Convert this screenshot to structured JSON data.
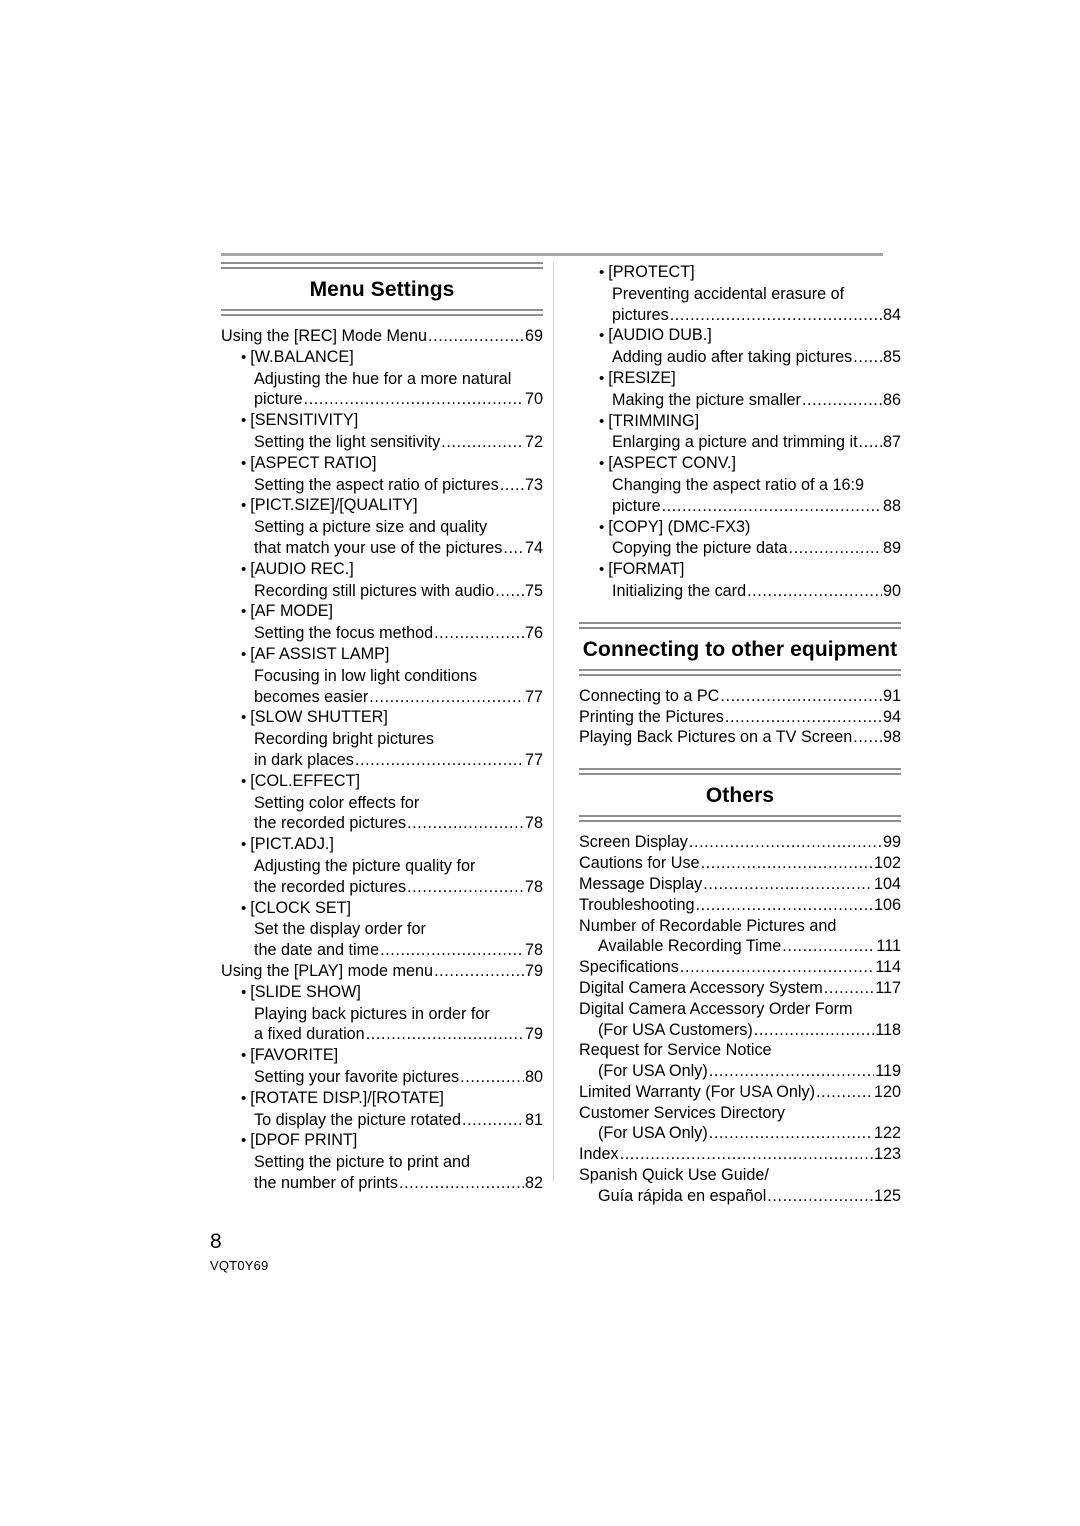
{
  "document": {
    "page_number": "8",
    "doc_code": "VQT0Y69"
  },
  "sections": {
    "menu_settings": {
      "title": "Menu Settings",
      "entries": [
        {
          "kind": "lvl1",
          "text": "Using the [REC] Mode Menu",
          "page": "69"
        },
        {
          "kind": "bullet",
          "text": "[W.BALANCE]"
        },
        {
          "kind": "desc",
          "text": "Adjusting the hue for a more natural"
        },
        {
          "kind": "desc",
          "text": "picture",
          "page": "70"
        },
        {
          "kind": "bullet",
          "text": "[SENSITIVITY]"
        },
        {
          "kind": "desc",
          "text": "Setting the light sensitivity",
          "page": "72"
        },
        {
          "kind": "bullet",
          "text": "[ASPECT RATIO]"
        },
        {
          "kind": "desc",
          "text": "Setting the aspect ratio of pictures",
          "page": "73"
        },
        {
          "kind": "bullet",
          "text": "[PICT.SIZE]/[QUALITY]"
        },
        {
          "kind": "desc",
          "text": "Setting a picture size and quality"
        },
        {
          "kind": "desc",
          "text": "that match your use of the pictures",
          "page": "74"
        },
        {
          "kind": "bullet",
          "text": "[AUDIO REC.]"
        },
        {
          "kind": "desc",
          "text": "Recording still pictures with audio",
          "page": "75"
        },
        {
          "kind": "bullet",
          "text": "[AF MODE]"
        },
        {
          "kind": "desc",
          "text": "Setting the focus method",
          "page": "76"
        },
        {
          "kind": "bullet",
          "text": "[AF ASSIST LAMP]"
        },
        {
          "kind": "desc",
          "text": "Focusing in low light conditions"
        },
        {
          "kind": "desc",
          "text": "becomes easier",
          "page": "77"
        },
        {
          "kind": "bullet",
          "text": "[SLOW SHUTTER]"
        },
        {
          "kind": "desc",
          "text": "Recording bright pictures"
        },
        {
          "kind": "desc",
          "text": "in dark places",
          "page": "77"
        },
        {
          "kind": "bullet",
          "text": "[COL.EFFECT]"
        },
        {
          "kind": "desc",
          "text": "Setting color effects for"
        },
        {
          "kind": "desc",
          "text": "the recorded pictures",
          "page": "78"
        },
        {
          "kind": "bullet",
          "text": "[PICT.ADJ.]"
        },
        {
          "kind": "desc",
          "text": "Adjusting the picture quality for"
        },
        {
          "kind": "desc",
          "text": "the recorded pictures",
          "page": "78"
        },
        {
          "kind": "bullet",
          "text": "[CLOCK SET]"
        },
        {
          "kind": "desc",
          "text": "Set the display order for"
        },
        {
          "kind": "desc",
          "text": "the date and time",
          "page": "78"
        },
        {
          "kind": "lvl1",
          "text": "Using the [PLAY] mode menu",
          "page": "79"
        },
        {
          "kind": "bullet",
          "text": "[SLIDE SHOW]"
        },
        {
          "kind": "desc",
          "text": "Playing back pictures in order for"
        },
        {
          "kind": "desc",
          "text": "a fixed duration",
          "page": "79"
        },
        {
          "kind": "bullet",
          "text": "[FAVORITE]"
        },
        {
          "kind": "desc",
          "text": "Setting your favorite pictures",
          "page": "80"
        },
        {
          "kind": "bullet",
          "text": "[ROTATE DISP.]/[ROTATE]"
        },
        {
          "kind": "desc",
          "text": "To display the picture rotated",
          "page": "81"
        },
        {
          "kind": "bullet",
          "text": "[DPOF PRINT]"
        },
        {
          "kind": "desc",
          "text": "Setting the picture to print and"
        },
        {
          "kind": "desc",
          "text": "the number of prints",
          "page": "82"
        }
      ]
    },
    "menu_settings_continued": {
      "entries": [
        {
          "kind": "bullet",
          "text": "[PROTECT]"
        },
        {
          "kind": "desc",
          "text": "Preventing accidental erasure of"
        },
        {
          "kind": "desc",
          "text": "pictures",
          "page": "84"
        },
        {
          "kind": "bullet",
          "text": "[AUDIO DUB.]"
        },
        {
          "kind": "desc",
          "text": "Adding audio after taking pictures",
          "page": "85"
        },
        {
          "kind": "bullet",
          "text": "[RESIZE]"
        },
        {
          "kind": "desc",
          "text": "Making the picture smaller",
          "page": "86"
        },
        {
          "kind": "bullet",
          "text": "[TRIMMING]"
        },
        {
          "kind": "desc",
          "text": "Enlarging a picture and trimming it",
          "page": "87"
        },
        {
          "kind": "bullet",
          "text": "[ASPECT CONV.]"
        },
        {
          "kind": "desc",
          "text": "Changing the aspect ratio of a 16:9"
        },
        {
          "kind": "desc",
          "text": "picture",
          "page": "88"
        },
        {
          "kind": "bullet",
          "text": "[COPY] (DMC-FX3)"
        },
        {
          "kind": "desc",
          "text": "Copying the picture data",
          "page": "89"
        },
        {
          "kind": "bullet",
          "text": "[FORMAT]"
        },
        {
          "kind": "desc",
          "text": "Initializing the card",
          "page": "90"
        }
      ]
    },
    "connecting": {
      "title": "Connecting to other equipment",
      "entries": [
        {
          "kind": "lvl1",
          "text": "Connecting to a PC",
          "page": "91"
        },
        {
          "kind": "lvl1",
          "text": "Printing the Pictures",
          "page": "94"
        },
        {
          "kind": "lvl1",
          "text": "Playing Back Pictures on a TV Screen",
          "page": "98"
        }
      ]
    },
    "others": {
      "title": "Others",
      "entries": [
        {
          "kind": "lvl1",
          "text": "Screen Display",
          "page": "99"
        },
        {
          "kind": "lvl1",
          "text": "Cautions for Use",
          "page": "102"
        },
        {
          "kind": "lvl1",
          "text": "Message Display",
          "page": "104"
        },
        {
          "kind": "lvl1",
          "text": "Troubleshooting",
          "page": "106"
        },
        {
          "kind": "lvl1",
          "text": "Number of Recordable Pictures and"
        },
        {
          "kind": "cont",
          "text": "Available Recording Time",
          "page": "111"
        },
        {
          "kind": "lvl1",
          "text": "Specifications",
          "page": "114"
        },
        {
          "kind": "lvl1",
          "text": "Digital Camera Accessory System",
          "page": "117"
        },
        {
          "kind": "lvl1",
          "text": "Digital Camera Accessory Order Form"
        },
        {
          "kind": "cont",
          "text": "(For USA Customers)",
          "page": "118"
        },
        {
          "kind": "lvl1",
          "text": "Request for Service Notice"
        },
        {
          "kind": "cont",
          "text": "(For USA Only)",
          "page": "119"
        },
        {
          "kind": "lvl1",
          "text": "Limited Warranty (For USA Only)",
          "page": "120"
        },
        {
          "kind": "lvl1",
          "text": "Customer Services Directory"
        },
        {
          "kind": "cont",
          "text": "(For USA Only)",
          "page": "122"
        },
        {
          "kind": "lvl1",
          "text": "Index",
          "page": "123"
        },
        {
          "kind": "lvl1",
          "text": "Spanish Quick Use Guide/"
        },
        {
          "kind": "cont",
          "text": "Guía rápida en español",
          "page": "125"
        }
      ]
    }
  }
}
